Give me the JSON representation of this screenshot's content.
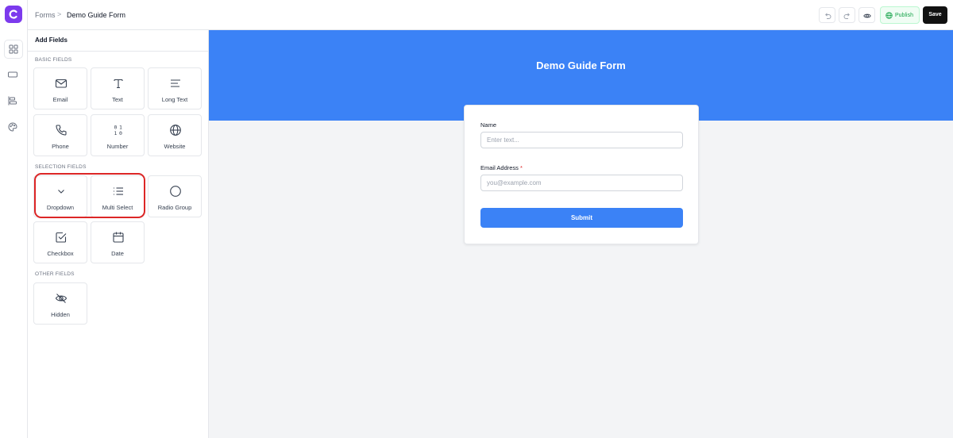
{
  "breadcrumb": {
    "root": "Forms",
    "separator": ">",
    "current": "Demo Guide Form"
  },
  "toolbar": {
    "publish_label": "Publish",
    "save_label": "Save"
  },
  "sidebar": {
    "title": "Add Fields",
    "sections": [
      "BASIC FIELDS",
      "SELECTION FIELDS",
      "OTHER FIELDS"
    ],
    "basic": [
      "Email",
      "Text",
      "Long Text",
      "Phone",
      "Number",
      "Website"
    ],
    "selection": [
      "Dropdown",
      "Multi Select",
      "Radio Group",
      "Checkbox",
      "Date"
    ],
    "other": [
      "Hidden"
    ]
  },
  "form": {
    "title": "Demo Guide Form",
    "fields": [
      {
        "label": "Name",
        "placeholder": "Enter text...",
        "required": false
      },
      {
        "label": "Email Address",
        "placeholder": "you@example.com",
        "required": true,
        "required_mark": "*"
      }
    ],
    "submit_label": "Submit"
  },
  "colors": {
    "brand": "#7c3aed",
    "accent": "#3b82f6",
    "publish": "#16a34a",
    "highlight": "#dc2626"
  }
}
